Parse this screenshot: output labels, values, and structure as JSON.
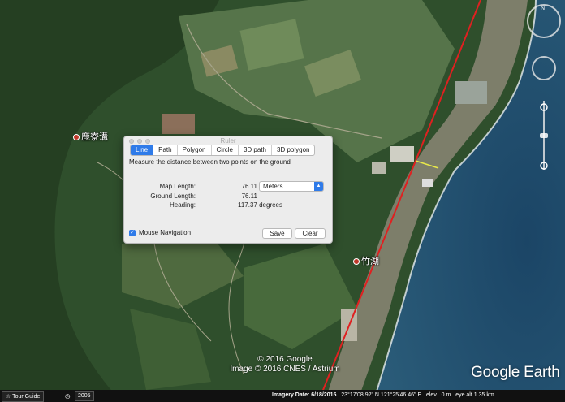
{
  "map": {
    "places": [
      {
        "label": "鹿寮溝"
      },
      {
        "label": "竹湖"
      }
    ],
    "copyright": [
      "© 2016 Google",
      "Image © 2016 CNES / Astrium"
    ],
    "logo": "Google Earth"
  },
  "ruler": {
    "title": "Ruler",
    "tabs": [
      "Line",
      "Path",
      "Polygon",
      "Circle",
      "3D path",
      "3D polygon"
    ],
    "active_tab": "Line",
    "description": "Measure the distance between two points on the ground",
    "map_length_label": "Map Length:",
    "map_length_value": "76.11",
    "units": "Meters",
    "ground_length_label": "Ground Length:",
    "ground_length_value": "76.11",
    "heading_label": "Heading:",
    "heading_value": "117.37 degrees",
    "mouse_navigation_label": "Mouse Navigation",
    "mouse_navigation_checked": true,
    "save_label": "Save",
    "clear_label": "Clear"
  },
  "statusbar": {
    "tour_guide": "Tour Guide",
    "year": "2005",
    "imagery_date_label": "Imagery Date:",
    "imagery_date": "6/18/2015",
    "lat": "23°17'08.92\" N",
    "lon": "121°25'46.46\" E",
    "elev_label": "elev",
    "elev": "0 m",
    "eye_alt_label": "eye alt",
    "eye_alt": "1.35 km"
  },
  "colors": {
    "ruler_line": "#e02020",
    "measure_line": "#e8e84a",
    "accent": "#2f7be9",
    "sea": "#1d4a6b",
    "land": "#3b5e34"
  }
}
